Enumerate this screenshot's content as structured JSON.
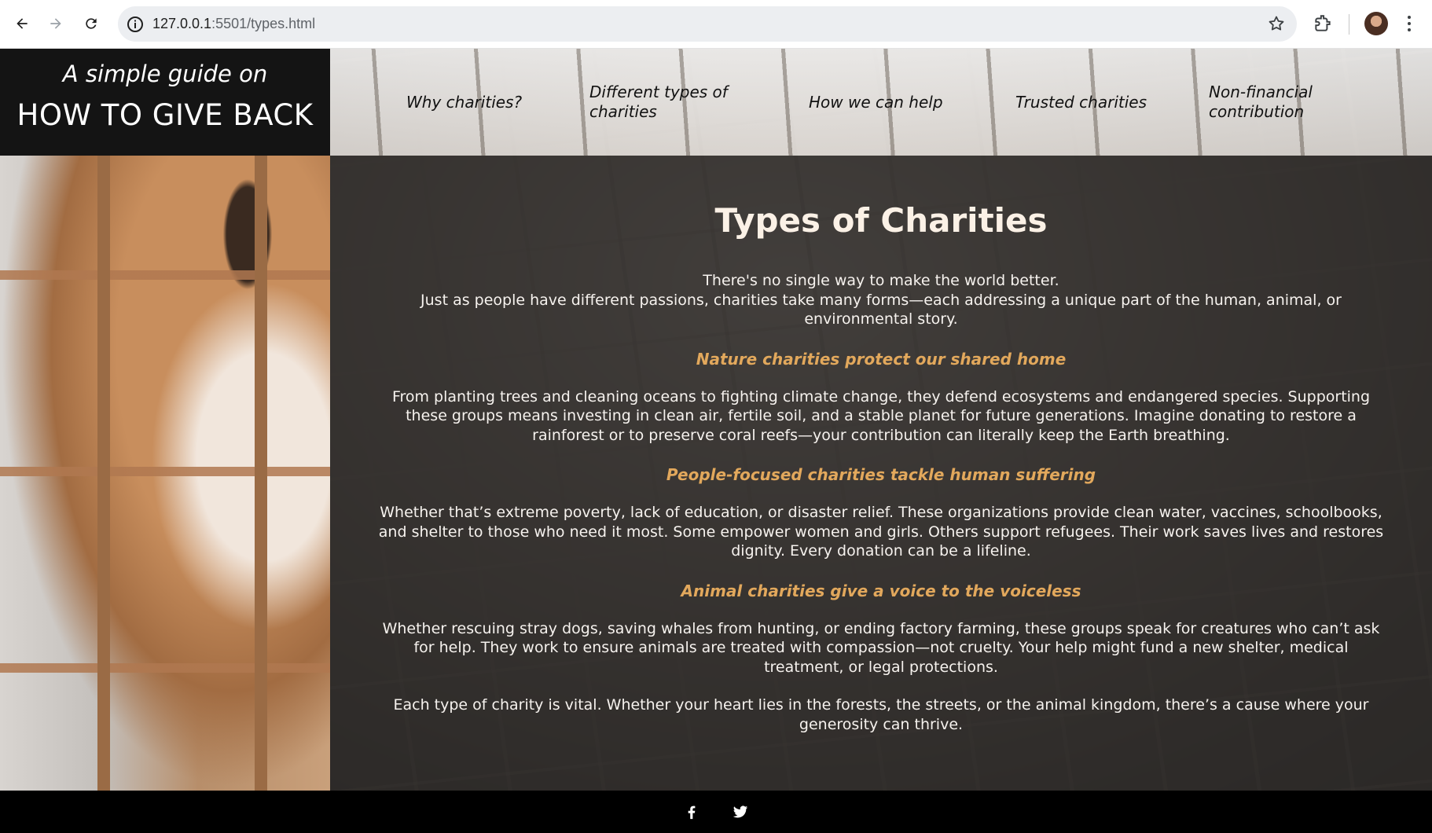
{
  "browser": {
    "url_host": "127.0.0.1",
    "url_path": ":5501/types.html",
    "icons": [
      "back-arrow-icon",
      "forward-arrow-icon",
      "reload-icon",
      "site-info-icon",
      "bookmark-star-icon",
      "extensions-icon",
      "profile-avatar",
      "kebab-menu-icon"
    ]
  },
  "brand": {
    "top": "A simple guide on",
    "main": "HOW TO GIVE BACK"
  },
  "nav": {
    "items": [
      {
        "label_line1": "Why charities?",
        "label_line2": ""
      },
      {
        "label_line1": "Different types of",
        "label_line2": "charities"
      },
      {
        "label_line1": "How we can help",
        "label_line2": ""
      },
      {
        "label_line1": "Trusted charities",
        "label_line2": ""
      },
      {
        "label_line1": "Non-financial",
        "label_line2": "contribution"
      }
    ]
  },
  "content": {
    "title": "Types of Charities",
    "intro_line1": "There's no single way to make the world better.",
    "intro_line2": "Just as people have different passions, charities take many forms—each addressing a unique part of the human, animal, or environmental story.",
    "sections": [
      {
        "heading": "Nature charities protect our shared home",
        "body": "From planting trees and cleaning oceans to fighting climate change, they defend ecosystems and endangered species. Supporting these groups means investing in clean air, fertile soil, and a stable planet for future generations. Imagine donating to restore a rainforest or to preserve coral reefs—your contribution can literally keep the Earth breathing."
      },
      {
        "heading": "People-focused charities tackle human suffering",
        "body": "Whether that’s extreme poverty, lack of education, or disaster relief. These organizations provide clean water, vaccines, schoolbooks, and shelter to those who need it most. Some empower women and girls. Others support refugees. Their work saves lives and restores dignity. Every donation can be a lifeline."
      },
      {
        "heading": "Animal charities give a voice to the voiceless",
        "body": "Whether rescuing stray dogs, saving whales from hunting, or ending factory farming, these groups speak for creatures who can’t ask for help. They work to ensure animals are treated with compassion—not cruelty. Your help might fund a new shelter, medical treatment, or legal protections."
      }
    ],
    "closing": "Each type of charity is vital. Whether your heart lies in the forests, the streets, or the animal kingdom, there’s a cause where your generosity can thrive."
  },
  "footer": {
    "icons": [
      "facebook-icon",
      "twitter-icon"
    ]
  },
  "colors": {
    "accent": "#e2a85c",
    "title": "#fbf1e6",
    "brand_bg": "#141414",
    "footer_bg": "#000000"
  }
}
